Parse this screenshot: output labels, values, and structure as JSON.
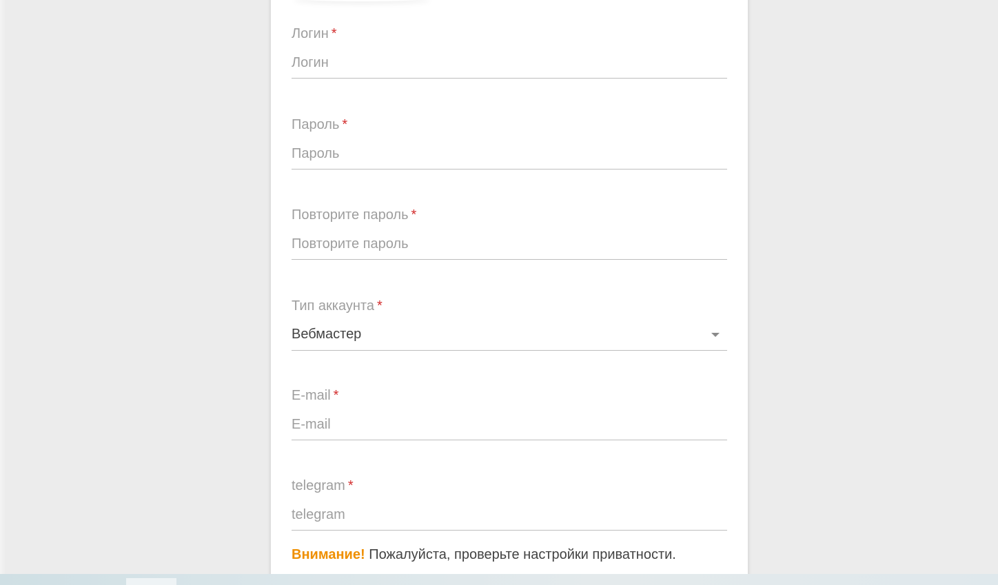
{
  "form": {
    "fields": [
      {
        "label": "Логин",
        "required_mark": "*",
        "placeholder": "Логин"
      },
      {
        "label": "Пароль",
        "required_mark": "*",
        "placeholder": "Пароль"
      },
      {
        "label": "Повторите пароль",
        "required_mark": "*",
        "placeholder": "Повторите пароль"
      },
      {
        "label": "Тип аккаунта",
        "required_mark": "*",
        "value": "Вебмастер",
        "icon": "chevron-down-icon"
      },
      {
        "label": "E-mail",
        "required_mark": "*",
        "placeholder": "E-mail"
      },
      {
        "label": "telegram",
        "required_mark": "*",
        "placeholder": "telegram"
      }
    ],
    "notice": {
      "strong": "Внимание!",
      "text": " Пожалуйста, проверьте настройки приватности."
    }
  },
  "colors": {
    "background": "#ececec",
    "card": "#ffffff",
    "label": "#9e9e9e",
    "required": "#d32f2f",
    "notice_strong": "#ef8f00",
    "underline": "#bdbdbd"
  }
}
